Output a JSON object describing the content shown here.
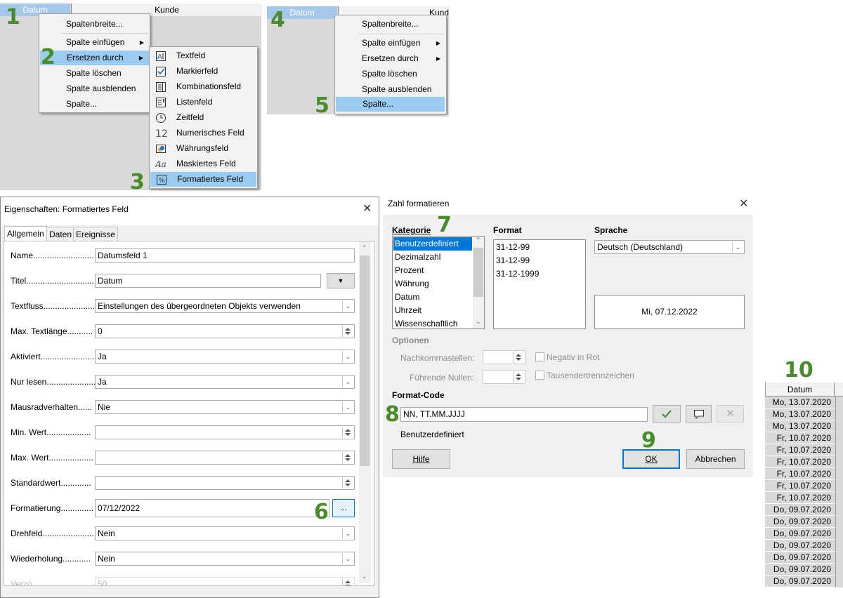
{
  "steps": [
    "1",
    "2",
    "3",
    "4",
    "5",
    "6",
    "7",
    "8",
    "9",
    "10"
  ],
  "panel1": {
    "col_datum": "Datum",
    "col_kunde": "Kunde",
    "menu": [
      "Spaltenbreite...",
      "Spalte einfügen",
      "Ersetzen durch",
      "Spalte löschen",
      "Spalte ausblenden",
      "Spalte..."
    ],
    "submenu": [
      "Textfeld",
      "Markierfeld",
      "Kombinationsfeld",
      "Listenfeld",
      "Zeitfeld",
      "Numerisches Feld",
      "Währungsfeld",
      "Maskiertes Feld",
      "Formatiertes Feld"
    ],
    "submenu_icons": [
      "textbox-icon",
      "checkbox-icon",
      "combobox-icon",
      "listbox-icon",
      "clock-icon",
      "numeric-icon",
      "currency-icon",
      "masked-icon",
      "formatted-icon"
    ]
  },
  "panel2": {
    "col_datum": "Datum",
    "col_kunde": "Kund",
    "menu": [
      "Spaltenbreite...",
      "Spalte einfügen",
      "Ersetzen durch",
      "Spalte löschen",
      "Spalte ausblenden",
      "Spalte..."
    ]
  },
  "props": {
    "title": "Eigenschaften: Formatiertes Feld",
    "tabs": [
      "Allgemein",
      "Daten",
      "Ereignisse"
    ],
    "rows": [
      {
        "label": "Name..........................",
        "value": "Datumsfeld 1",
        "kind": "text"
      },
      {
        "label": "Titel..............................",
        "value": "Datum",
        "kind": "title"
      },
      {
        "label": "Textfluss.......................",
        "value": "Einstellungen des übergeordneten Objekts verwenden",
        "kind": "dropdown"
      },
      {
        "label": "Max. Textlänge...........",
        "value": "0",
        "kind": "spin"
      },
      {
        "label": "Aktiviert.......................",
        "value": "Ja",
        "kind": "dropdown"
      },
      {
        "label": "Nur lesen......................",
        "value": "Ja",
        "kind": "dropdown"
      },
      {
        "label": "Mausradverhalten......",
        "value": "Nie",
        "kind": "dropdown"
      },
      {
        "label": "Min. Wert...................",
        "value": "",
        "kind": "spin"
      },
      {
        "label": "Max. Wert...................",
        "value": "",
        "kind": "spin"
      },
      {
        "label": "Standardwert.............",
        "value": "",
        "kind": "spin"
      },
      {
        "label": "Formatierung..............",
        "value": "07/12/2022",
        "kind": "button"
      },
      {
        "label": "Drehfeld.......................",
        "value": "Nein",
        "kind": "dropdown"
      },
      {
        "label": "Wiederholung............",
        "value": "Nein",
        "kind": "dropdown"
      },
      {
        "label": "Verzö...",
        "value": "50",
        "kind": "partial"
      }
    ],
    "ellipsis": "..."
  },
  "zahl": {
    "title": "Zahl formatieren",
    "kategorie_label": "Kategorie",
    "kategorie": [
      "Benutzerdefiniert",
      "Dezimalzahl",
      "Prozent",
      "Währung",
      "Datum",
      "Uhrzeit",
      "Wissenschaftlich"
    ],
    "format_label": "Format",
    "formats": [
      "31-12-99",
      "31-12-99",
      "31-12-1999"
    ],
    "sprache_label": "Sprache",
    "sprache": "Deutsch (Deutschland)",
    "preview": "Mi, 07.12.2022",
    "optionen": "Optionen",
    "nachkomma": "Nachkommastellen:",
    "nullen": "Führende Nullen:",
    "negativ": "Negativ in Rot",
    "tausender": "Tausendertrennzeichen",
    "formatcode_label": "Format-Code",
    "formatcode": "NN, TT.MM.JJJJ",
    "desc": "Benutzerdefiniert",
    "hilfe": "Hilfe",
    "ok": "OK",
    "abbrechen": "Abbrechen"
  },
  "grid": {
    "header": "Datum",
    "rows": [
      "Mo, 13.07.2020",
      "Mo, 13.07.2020",
      "Mo, 13.07.2020",
      "Fr, 10.07.2020",
      "Fr, 10.07.2020",
      "Fr, 10.07.2020",
      "Fr, 10.07.2020",
      "Fr, 10.07.2020",
      "Fr, 10.07.2020",
      "Do, 09.07.2020",
      "Do, 09.07.2020",
      "Do, 09.07.2020",
      "Do, 09.07.2020",
      "Do, 09.07.2020",
      "Do, 09.07.2020",
      "Do, 09.07.2020"
    ]
  }
}
